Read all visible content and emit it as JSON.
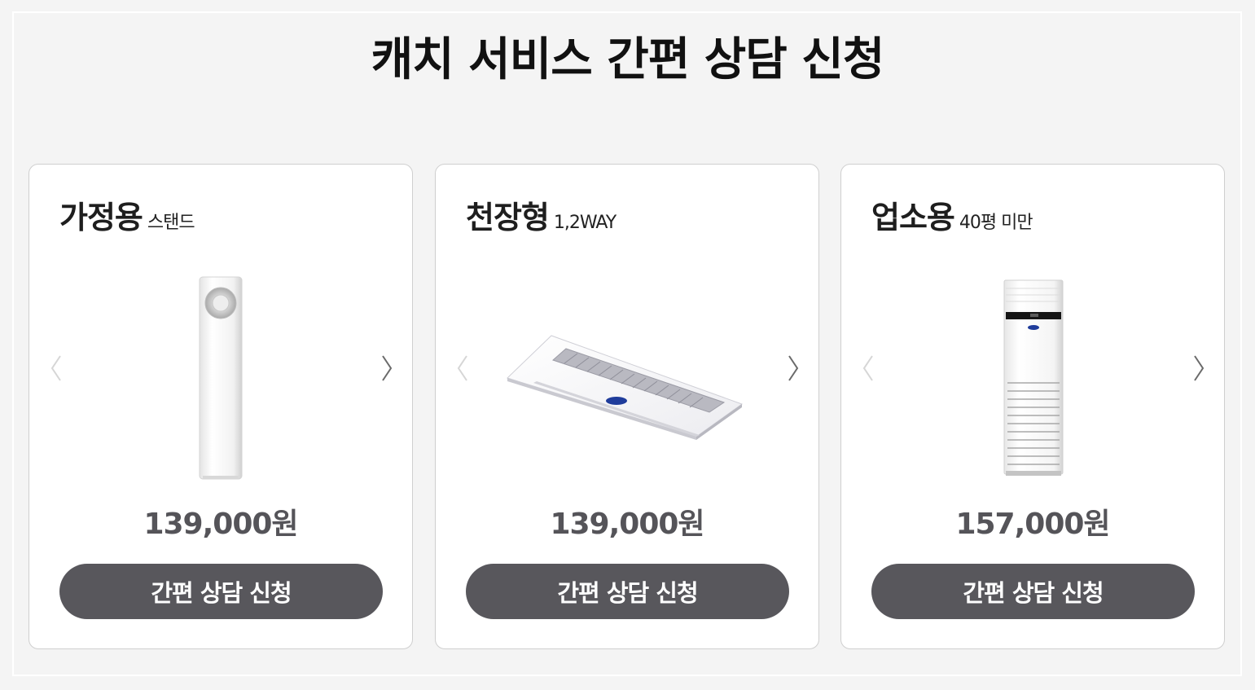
{
  "page": {
    "title": "캐치 서비스 간편 상담 신청"
  },
  "cards": [
    {
      "title": "가정용",
      "subtitle": "스탠드",
      "product_icon": "stand-air-conditioner",
      "price": "139,000원",
      "button_label": "간편 상담 신청"
    },
    {
      "title": "천장형",
      "subtitle": "1,2WAY",
      "product_icon": "ceiling-air-conditioner",
      "price": "139,000원",
      "button_label": "간편 상담 신청"
    },
    {
      "title": "업소용",
      "subtitle": "40평 미만",
      "product_icon": "commercial-air-conditioner",
      "price": "157,000원",
      "button_label": "간편 상담 신청"
    }
  ],
  "carousel": {
    "prev_icon": "chevron-left-icon",
    "next_icon": "chevron-right-icon"
  },
  "colors": {
    "page_background": "#f4f4f4",
    "card_background": "#ffffff",
    "button_background": "#58575c",
    "price_text": "#555459"
  }
}
